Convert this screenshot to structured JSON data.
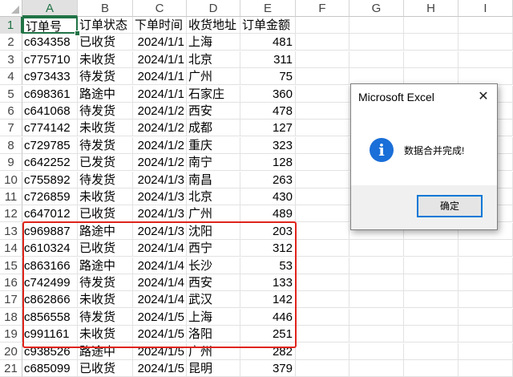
{
  "columns": [
    "A",
    "B",
    "C",
    "D",
    "E",
    "F",
    "G",
    "H",
    "I"
  ],
  "row_numbers": [
    "1",
    "2",
    "3",
    "4",
    "5",
    "6",
    "7",
    "8",
    "9",
    "10",
    "11",
    "12",
    "13",
    "14",
    "15",
    "16",
    "17",
    "18",
    "19",
    "20",
    "21"
  ],
  "header": [
    "订单号",
    "订单状态",
    "下单时间",
    "收货地址",
    "订单金额"
  ],
  "rows": [
    [
      "c634358",
      "已收货",
      "2024/1/1",
      "上海",
      "481"
    ],
    [
      "c775710",
      "未收货",
      "2024/1/1",
      "北京",
      "311"
    ],
    [
      "c973433",
      "待发货",
      "2024/1/1",
      "广州",
      "75"
    ],
    [
      "c698361",
      "路途中",
      "2024/1/1",
      "石家庄",
      "360"
    ],
    [
      "c641068",
      "待发货",
      "2024/1/2",
      "西安",
      "478"
    ],
    [
      "c774142",
      "未收货",
      "2024/1/2",
      "成都",
      "127"
    ],
    [
      "c729785",
      "待发货",
      "2024/1/2",
      "重庆",
      "323"
    ],
    [
      "c642252",
      "已发货",
      "2024/1/2",
      "南宁",
      "128"
    ],
    [
      "c755892",
      "待发货",
      "2024/1/3",
      "南昌",
      "263"
    ],
    [
      "c726859",
      "未收货",
      "2024/1/3",
      "北京",
      "430"
    ],
    [
      "c647012",
      "已收货",
      "2024/1/3",
      "广州",
      "489"
    ],
    [
      "c969887",
      "路途中",
      "2024/1/3",
      "沈阳",
      "203"
    ],
    [
      "c610324",
      "已收货",
      "2024/1/4",
      "西宁",
      "312"
    ],
    [
      "c863166",
      "路途中",
      "2024/1/4",
      "长沙",
      "53"
    ],
    [
      "c742499",
      "待发货",
      "2024/1/4",
      "西安",
      "133"
    ],
    [
      "c862866",
      "未收货",
      "2024/1/4",
      "武汉",
      "142"
    ],
    [
      "c856558",
      "待发货",
      "2024/1/5",
      "上海",
      "446"
    ],
    [
      "c991161",
      "未收货",
      "2024/1/5",
      "洛阳",
      "251"
    ],
    [
      "c938526",
      "路途中",
      "2024/1/5",
      "广州",
      "282"
    ],
    [
      "c685099",
      "已收货",
      "2024/1/5",
      "昆明",
      "379"
    ]
  ],
  "dialog": {
    "title": "Microsoft Excel",
    "message": "数据合并完成!",
    "ok_label": "确定",
    "close_glyph": "✕",
    "icon_glyph": "i"
  },
  "colors": {
    "selection": "#217346",
    "highlight": "#e0241b",
    "info_icon": "#1a6fd8"
  }
}
